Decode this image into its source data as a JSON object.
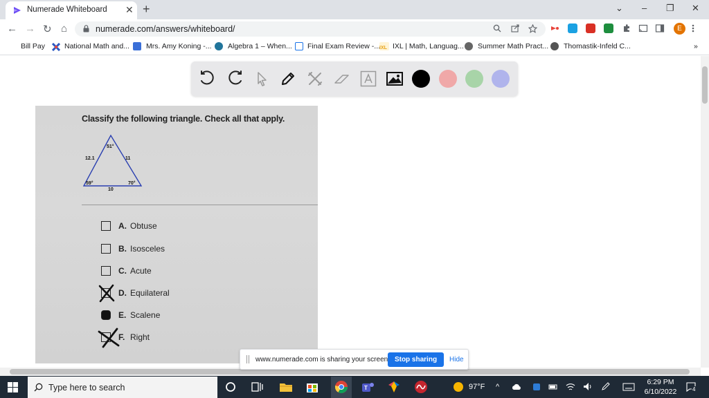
{
  "browser": {
    "tab_title": "Numerade Whiteboard",
    "tab_close": "✕",
    "new_tab": "+",
    "url": "numerade.com/answers/whiteboard/",
    "profile_initial": "E",
    "window": {
      "minimize": "–",
      "restore": "❐",
      "close": "✕",
      "tabsearch": "⌄"
    },
    "nav": {
      "back": "←",
      "forward": "→",
      "reload": "↻",
      "home": "⌂"
    }
  },
  "bookmarks": [
    {
      "label": "Bill Pay",
      "icon": "bookmark-bill-pay",
      "color": "#ffffff"
    },
    {
      "label": "National Math and...",
      "icon": "bookmark-national-math",
      "color": "#2b59c3"
    },
    {
      "label": "Mrs. Amy Koning -...",
      "icon": "bookmark-calendar",
      "color": "#3a6fd8"
    },
    {
      "label": "Algebra 1 – When...",
      "icon": "bookmark-wordpress",
      "color": "#21759b"
    },
    {
      "label": "Final Exam Review -...",
      "icon": "bookmark-doc",
      "color": "#1a73e8"
    },
    {
      "label": "IXL | Math, Languag...",
      "icon": "bookmark-ixl",
      "color": "#e8a317"
    },
    {
      "label": "Summer Math Pract...",
      "icon": "bookmark-summer",
      "color": "#555555"
    },
    {
      "label": "Thomastik-Infeld C...",
      "icon": "bookmark-globe",
      "color": "#555555"
    }
  ],
  "bookmarks_more": "»",
  "whiteboard": {
    "tools": [
      "undo-icon",
      "redo-icon",
      "select-icon",
      "pen-icon",
      "tools-icon",
      "eraser-icon",
      "text-icon",
      "image-icon"
    ],
    "colors": [
      "#000000",
      "#f0a8a8",
      "#a8d4a8",
      "#b0b4ec"
    ]
  },
  "worksheet": {
    "question": "Classify the following triangle. Check all that apply.",
    "triangle": {
      "top_angle": "51°",
      "left_side": "12.1",
      "right_side": "11",
      "left_angle": "59°",
      "right_angle": "70°",
      "base": "10"
    },
    "options": [
      {
        "letter": "A.",
        "text": "Obtuse",
        "mark": "none"
      },
      {
        "letter": "B.",
        "text": "Isosceles",
        "mark": "none"
      },
      {
        "letter": "C.",
        "text": "Acute",
        "mark": "none"
      },
      {
        "letter": "D.",
        "text": "Equilateral",
        "mark": "crossed"
      },
      {
        "letter": "E.",
        "text": "Scalene",
        "mark": "filled"
      },
      {
        "letter": "F.",
        "text": "Right",
        "mark": "crossed"
      }
    ]
  },
  "share_banner": {
    "message": "www.numerade.com is sharing your screen.",
    "stop_label": "Stop sharing",
    "hide_label": "Hide"
  },
  "taskbar": {
    "search_placeholder": "Type here to search",
    "weather": "97°F",
    "time": "6:29 PM",
    "date": "6/10/2022",
    "notification_count": "4"
  }
}
